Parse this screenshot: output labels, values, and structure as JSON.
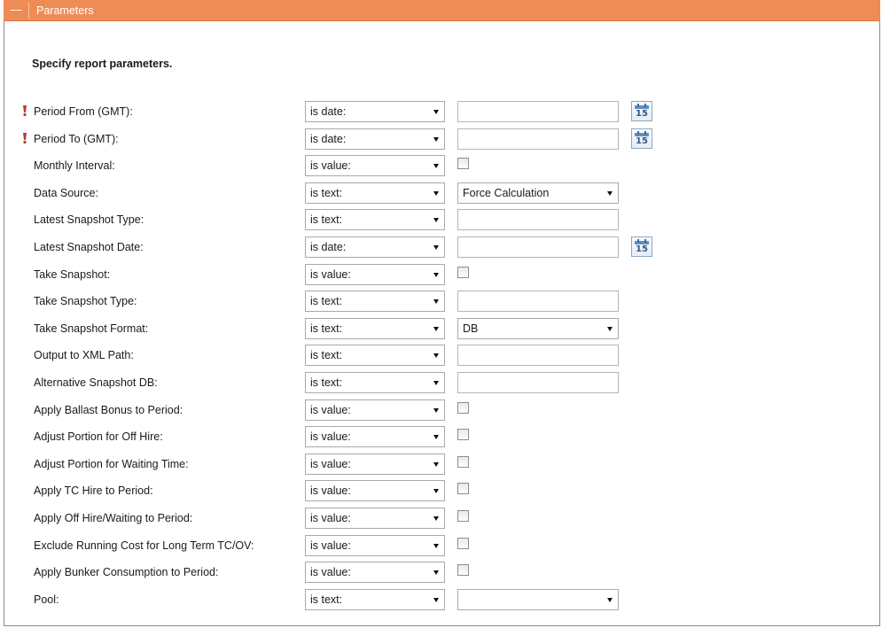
{
  "panel": {
    "title": "Parameters",
    "collapse_glyph": "—",
    "instructions": "Specify report parameters."
  },
  "calendar_icon_text": "15",
  "colors": {
    "header": "#ef8c55",
    "required_marker": "#c0392b"
  },
  "rows": [
    {
      "label": "Period From (GMT):",
      "required": true,
      "operator": "is date:",
      "control": "date",
      "value": ""
    },
    {
      "label": "Period To (GMT):",
      "required": true,
      "operator": "is date:",
      "control": "date",
      "value": ""
    },
    {
      "label": "Monthly Interval:",
      "required": false,
      "operator": "is value:",
      "control": "checkbox",
      "checked": false
    },
    {
      "label": "Data Source:",
      "required": false,
      "operator": "is text:",
      "control": "select",
      "value": "Force Calculation"
    },
    {
      "label": "Latest Snapshot Type:",
      "required": false,
      "operator": "is text:",
      "control": "text",
      "value": ""
    },
    {
      "label": "Latest Snapshot Date:",
      "required": false,
      "operator": "is date:",
      "control": "date",
      "value": ""
    },
    {
      "label": "Take Snapshot:",
      "required": false,
      "operator": "is value:",
      "control": "checkbox",
      "checked": false
    },
    {
      "label": "Take Snapshot Type:",
      "required": false,
      "operator": "is text:",
      "control": "text",
      "value": ""
    },
    {
      "label": "Take Snapshot Format:",
      "required": false,
      "operator": "is text:",
      "control": "select",
      "value": "DB"
    },
    {
      "label": "Output to XML Path:",
      "required": false,
      "operator": "is text:",
      "control": "text",
      "value": ""
    },
    {
      "label": "Alternative Snapshot DB:",
      "required": false,
      "operator": "is text:",
      "control": "text",
      "value": ""
    },
    {
      "label": "Apply Ballast Bonus to Period:",
      "required": false,
      "operator": "is value:",
      "control": "checkbox",
      "checked": false
    },
    {
      "label": "Adjust Portion for Off Hire:",
      "required": false,
      "operator": "is value:",
      "control": "checkbox",
      "checked": false
    },
    {
      "label": "Adjust Portion for Waiting Time:",
      "required": false,
      "operator": "is value:",
      "control": "checkbox",
      "checked": false
    },
    {
      "label": "Apply TC Hire to Period:",
      "required": false,
      "operator": "is value:",
      "control": "checkbox",
      "checked": false
    },
    {
      "label": "Apply Off Hire/Waiting to Period:",
      "required": false,
      "operator": "is value:",
      "control": "checkbox",
      "checked": false
    },
    {
      "label": "Exclude Running Cost for Long Term TC/OV:",
      "required": false,
      "operator": "is value:",
      "control": "checkbox",
      "checked": false
    },
    {
      "label": "Apply Bunker Consumption to Period:",
      "required": false,
      "operator": "is value:",
      "control": "checkbox",
      "checked": false
    },
    {
      "label": "Pool:",
      "required": false,
      "operator": "is text:",
      "control": "select",
      "value": ""
    }
  ]
}
